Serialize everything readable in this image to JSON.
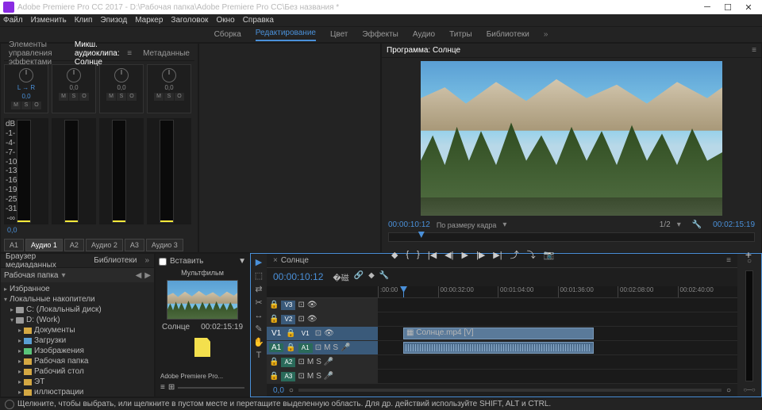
{
  "titlebar": {
    "title": "Adobe Premiere Pro CC 2017 - D:\\Рабочая папка\\Adobe Premiere Pro CC\\Без названия *"
  },
  "menu": [
    "Файл",
    "Изменить",
    "Клип",
    "Эпизод",
    "Маркер",
    "Заголовок",
    "Окно",
    "Справка"
  ],
  "workspaces": {
    "items": [
      "Сборка",
      "Редактирование",
      "Цвет",
      "Эффекты",
      "Аудио",
      "Титры",
      "Библиотеки"
    ],
    "active_index": 1
  },
  "fx_panel": {
    "header": "Элементы управления эффектами",
    "tabs": [
      "Микш. аудиоклипа: Солнце",
      "Метаданные"
    ],
    "knob_labels": {
      "lr": "L → R",
      "val": "0,0"
    },
    "mso": [
      "M",
      "S",
      "O"
    ],
    "scale": [
      "dB",
      "-1-",
      "-4-",
      "-7-",
      "-10-",
      "-13-",
      "-16-",
      "-19-",
      "-25-",
      "-31-",
      "-∞"
    ],
    "bottom_val": "0,0",
    "audio_tabs": [
      "A1",
      "Аудио 1",
      "A2",
      "Аудио 2",
      "A3",
      "Аудио 3"
    ]
  },
  "program": {
    "title": "Программа: Солнце",
    "tc_left": "00:00:10:12",
    "fit": "По размеру кадра",
    "zoom": "1/2",
    "tc_right": "00:02:15:19"
  },
  "browser": {
    "tabs": [
      "Браузер медиаданных",
      "Библиотеки"
    ],
    "path": "Рабочая папка",
    "insert_label": "Вставить",
    "header2": "Мультфильм",
    "tree": {
      "fav": "Избранное",
      "local": "Локальные накопители",
      "c": "C: (Локальный диск)",
      "d": "D: (Work)",
      "docs": "Документы",
      "dl": "Загрузки",
      "img": "Изображения",
      "wf": "Рабочая папка",
      "dt": "Рабочий стол",
      "et": "ЭТ",
      "ill": "иллюстрации"
    },
    "thumb_name": "Солнце",
    "thumb_dur": "00:02:15:19",
    "footer": "Adobe Premiere Pro..."
  },
  "timeline": {
    "seq_name": "Солнце",
    "tc": "00:00:10:12",
    "ruler": [
      ":00:00",
      "00:00:32:00",
      "00:01:04:00",
      "00:01:36:00",
      "00:02:08:00",
      "00:02:40:00"
    ],
    "tracks": {
      "v3": "V3",
      "v2": "V2",
      "v1": "V1",
      "a1": "A1",
      "a2": "A2",
      "a3": "A3"
    },
    "clip_name": "Солнце.mp4 [V]",
    "footer_val": "0,0"
  },
  "status": "Щелкните, чтобы выбрать, или щелкните в пустом месте и перетащите выделенную область. Для др. действий используйте SHIFT, ALT и CTRL."
}
